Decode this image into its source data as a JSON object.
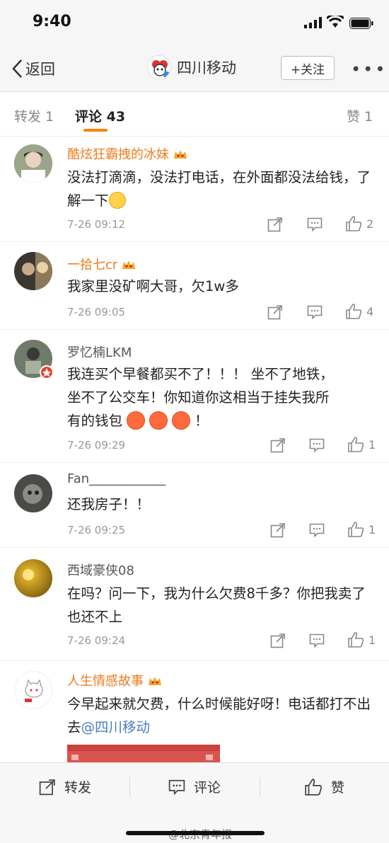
{
  "status_bar": {
    "time": "9:40"
  },
  "nav": {
    "back_label": "返回",
    "title": "四川移动",
    "follow_label": "+关注",
    "more_label": "•••"
  },
  "tabs": {
    "repost": "转发 1",
    "comments": "评论 43",
    "likes": "赞 1"
  },
  "comments": [
    {
      "name": "酷炫狂霸拽的冰妹",
      "text": "没法打滴滴，没法打电话，在外面都没法给钱，了解一下",
      "time": "7-26 09:12",
      "likes": "2"
    },
    {
      "name": "一拾七cr",
      "text": "我家里没矿啊大哥，欠1w多",
      "time": "7-26 09:05",
      "likes": "4"
    },
    {
      "name": "罗忆楠LKM",
      "text_line1": "我连买个早餐都买不了！！！ 坐不了地铁，",
      "text_line2": "坐不了公交车！你知道你这相当于挂失我所",
      "text_line3_prefix": "有的钱包",
      "text_line3_suffix": "！",
      "time": "7-26 09:29",
      "likes": "1"
    },
    {
      "name": "Fan____________",
      "text": "还我房子！！",
      "time": "7-26 09:25",
      "likes": "1"
    },
    {
      "name": "西域豪侠08",
      "text": "在吗？问一下，我为什么欠费8千多？你把我卖了也还不上",
      "time": "7-26 09:24",
      "likes": "1"
    },
    {
      "name": "人生情感故事",
      "text_main": "今早起来就欠费，什么时候能好呀！电话都打不出去",
      "mention": "@四川移动"
    }
  ],
  "bottom_bar": {
    "repost": "转发",
    "comment": "评论",
    "like": "赞",
    "watermark": "@北京青年报"
  },
  "colors": {
    "accent": "#ff8200",
    "name_orange": "#ef7c1d",
    "mention": "#4a7dbf"
  }
}
